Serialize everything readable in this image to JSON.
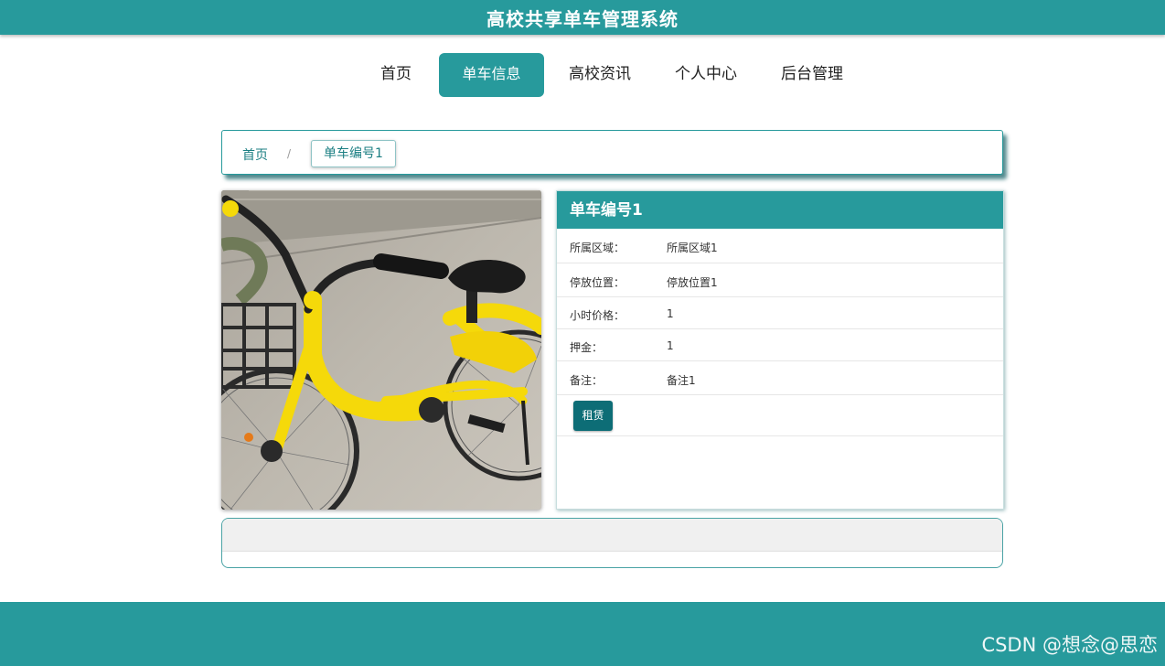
{
  "header": {
    "title": "高校共享单车管理系统"
  },
  "nav": {
    "items": [
      {
        "label": "首页"
      },
      {
        "label": "单车信息",
        "active": true
      },
      {
        "label": "高校资讯"
      },
      {
        "label": "个人中心"
      },
      {
        "label": "后台管理"
      }
    ]
  },
  "breadcrumb": {
    "home": "首页",
    "separator": "/",
    "current": "单车编号1"
  },
  "detail": {
    "title": "单车编号1",
    "fields": [
      {
        "key": "所属区域：",
        "value": "所属区域1"
      },
      {
        "key": "停放位置：",
        "value": "停放位置1"
      },
      {
        "key": "小时价格：",
        "value": "1"
      },
      {
        "key": "押金：",
        "value": "1"
      },
      {
        "key": "备注：",
        "value": "备注1"
      }
    ],
    "rent_button": "租赁"
  },
  "watermark": "CSDN @想念@思恋",
  "colors": {
    "primary": "#279a9c",
    "button": "#0d6d76",
    "bike_yellow": "#f5d90a"
  }
}
